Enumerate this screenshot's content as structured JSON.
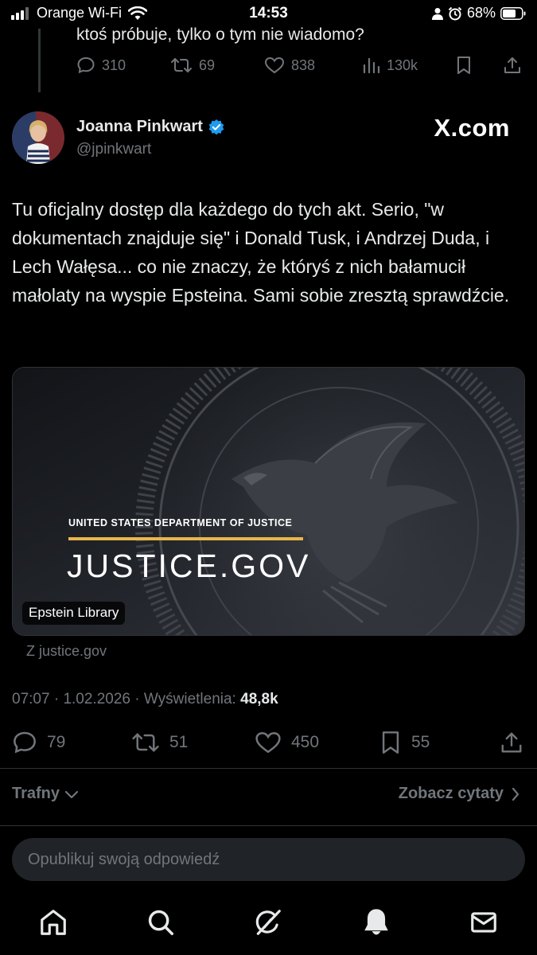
{
  "status_bar": {
    "carrier": "Orange Wi-Fi",
    "time": "14:53",
    "battery": "68%"
  },
  "previous_tweet": {
    "text_tail": "ktoś próbuje, tylko o tym nie wiadomo?",
    "replies": "310",
    "retweets": "69",
    "likes": "838",
    "views": "130k"
  },
  "tweet": {
    "author_name": "Joanna Pinkwart",
    "author_handle": "@jpinkwart",
    "watermark": "X.com",
    "text": "Tu oficjalny dostęp dla każdego do tych akt. Serio, \"w dokumentach znajduje się\" i Donald Tusk, i Andrzej Duda, i Lech Wałęsa... co nie znaczy, że któryś z nich bałamucił małolaty na wyspie Epsteina. Sami sobie zresztą sprawdźcie.",
    "card": {
      "small_heading": "UNITED STATES DEPARTMENT OF JUSTICE",
      "big_heading": "JUSTICE.GOV",
      "label": "Epstein Library",
      "source": "Z justice.gov",
      "accent_color": "#e8b64a"
    },
    "meta": {
      "time": "07:07",
      "date": "1.02.2026",
      "views_label": "Wyświetlenia:",
      "views_value": "48,8k"
    },
    "actions": {
      "replies": "79",
      "retweets": "51",
      "likes": "450",
      "bookmarks": "55"
    }
  },
  "sort": {
    "label": "Trafny",
    "quotes_link": "Zobacz cytaty"
  },
  "reply_box": {
    "placeholder": "Opublikuj swoją odpowiedź"
  },
  "tab_bar": {
    "icons": [
      "home-icon",
      "search-icon",
      "grok-icon",
      "bell-icon",
      "mail-icon"
    ]
  },
  "colors": {
    "background": "#000000",
    "text": "#e7e9ea",
    "muted": "#71767b",
    "verified": "#1d9bf0"
  }
}
